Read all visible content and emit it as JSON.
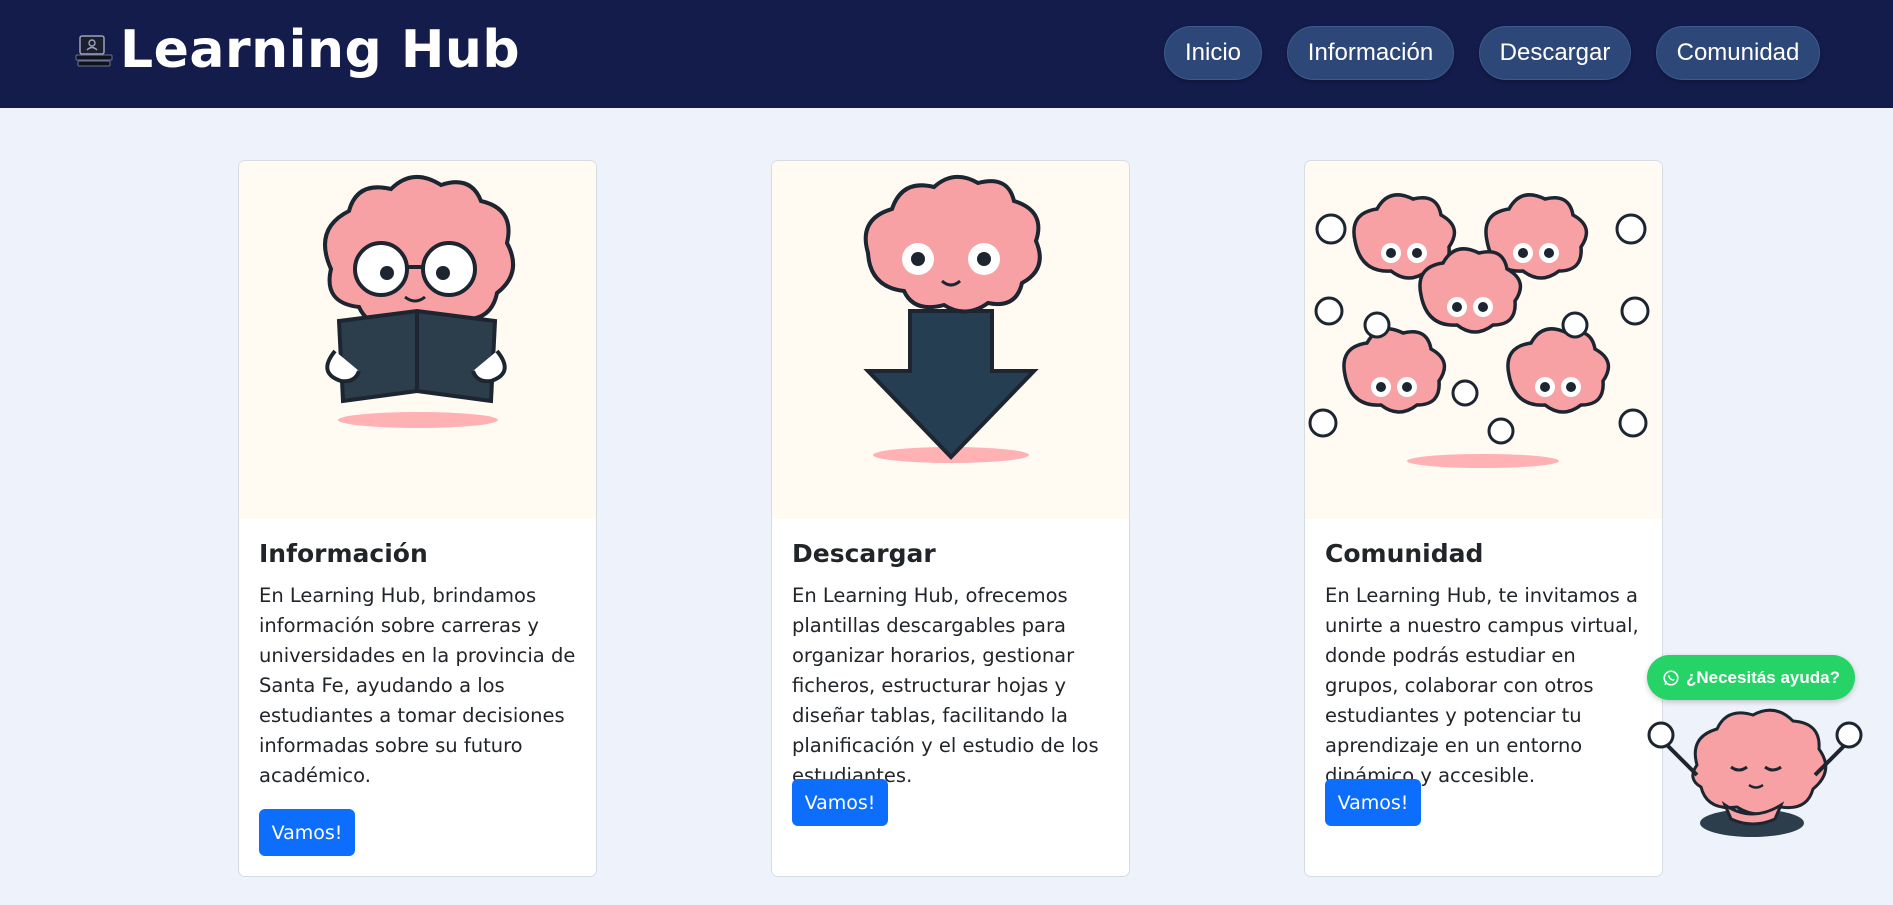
{
  "header": {
    "brand": "Learning Hub",
    "brand_icon": "books-laptop-icon",
    "nav": [
      "Inicio",
      "Información",
      "Descargar",
      "Comunidad"
    ]
  },
  "cards": [
    {
      "title": "Información",
      "text": "En Learning Hub, brindamos información sobre carreras y universidades en la provincia de Santa Fe, ayudando a los estudiantes a tomar decisiones informadas sobre su futuro académico.",
      "button": "Vamos!",
      "image": "brain-reading-book-icon"
    },
    {
      "title": "Descargar",
      "text": "En Learning Hub, ofrecemos plantillas descargables para organizar horarios, gestionar ficheros, estructurar hojas y diseñar tablas, facilitando la planificación y el estudio de los estudiantes.",
      "button": "Vamos!",
      "image": "brain-download-arrow-icon"
    },
    {
      "title": "Comunidad",
      "text": "En Learning Hub, te invitamos a unirte a nuestro campus virtual, donde podrás estudiar en grupos, colaborar con otros estudiantes y potenciar tu aprendizaje en un entorno dinámico y accesible.",
      "button": "Vamos!",
      "image": "brain-community-icon"
    }
  ],
  "help": {
    "label": "¿Necesitás ayuda?",
    "icon": "whatsapp-icon",
    "mascot": "meditating-brain-icon"
  },
  "colors": {
    "header_bg": "#141c4b",
    "page_bg": "#eef2fa",
    "nav_pill": "#2d4878",
    "primary_button": "#0d6efd",
    "help_button": "#25d366",
    "brain_pink": "#f7a1a4"
  }
}
